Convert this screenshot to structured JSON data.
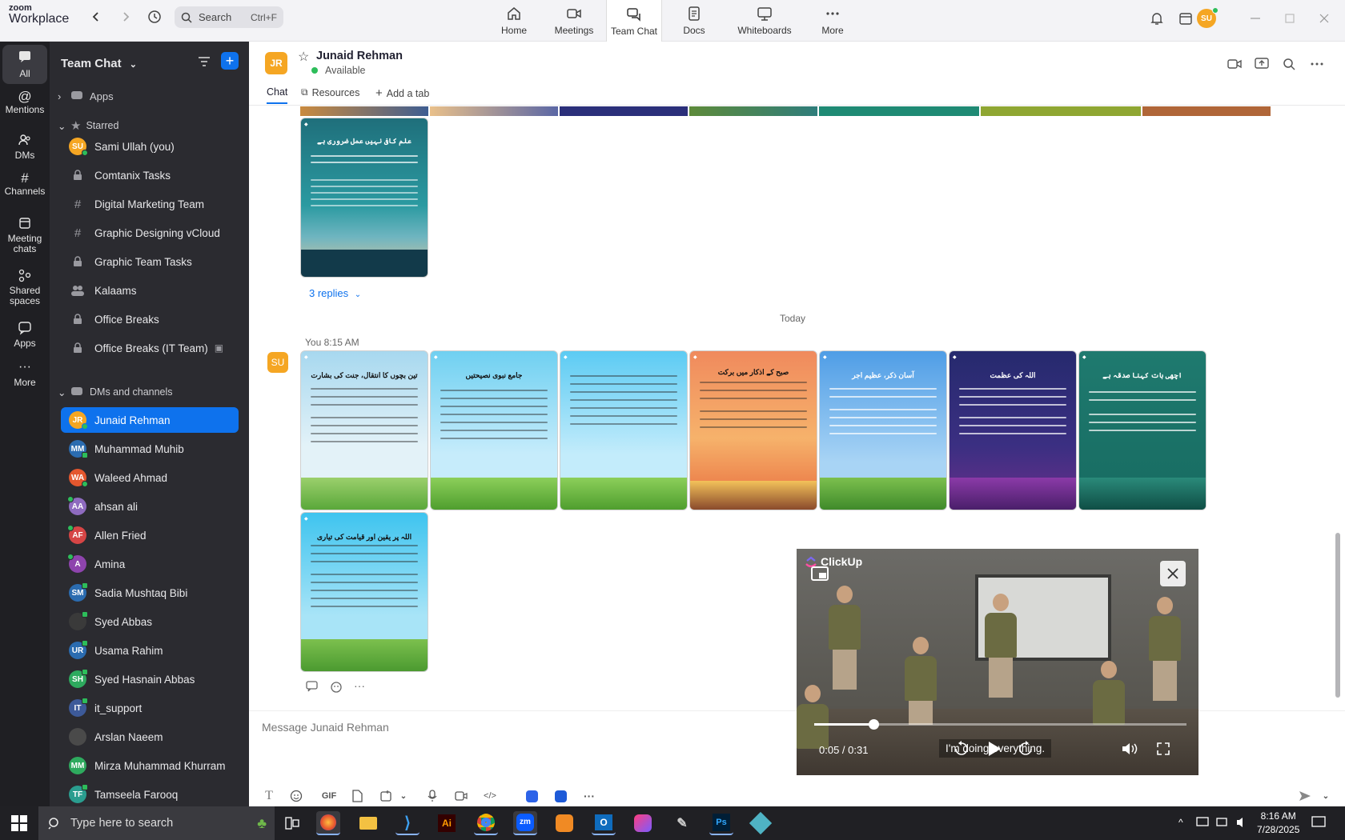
{
  "app": {
    "logo_line1": "zoom",
    "logo_line2": "Workplace"
  },
  "search": {
    "label": "Search",
    "shortcut": "Ctrl+F"
  },
  "nav_tabs": [
    {
      "label": "Home",
      "icon": "home-icon"
    },
    {
      "label": "Meetings",
      "icon": "video-camera-icon"
    },
    {
      "label": "Team Chat",
      "icon": "chat-icon",
      "active": true
    },
    {
      "label": "Docs",
      "icon": "document-icon"
    },
    {
      "label": "Whiteboards",
      "icon": "whiteboard-icon"
    },
    {
      "label": "More",
      "icon": "more-dots-icon"
    }
  ],
  "user": {
    "initials": "SU"
  },
  "rail": [
    {
      "label": "All",
      "active": true
    },
    {
      "label": "Mentions"
    },
    {
      "label": "DMs"
    },
    {
      "label": "Channels"
    },
    {
      "label": "Meeting chats"
    },
    {
      "label": "Shared spaces"
    },
    {
      "label": "Apps"
    },
    {
      "label": "More"
    }
  ],
  "sidebar": {
    "title": "Team Chat",
    "apps_label": "Apps",
    "starred_label": "Starred",
    "starred": [
      {
        "name": "Sami Ullah (you)",
        "initials": "SU",
        "color": "#f5a623",
        "kind": "user"
      },
      {
        "name": "Comtanix Tasks",
        "kind": "lock"
      },
      {
        "name": "Digital Marketing Team",
        "kind": "hash"
      },
      {
        "name": "Graphic Designing vCloud",
        "kind": "hash"
      },
      {
        "name": "Graphic Team Tasks",
        "kind": "lock"
      },
      {
        "name": "Kalaams",
        "kind": "group"
      },
      {
        "name": "Office Breaks",
        "kind": "lock"
      },
      {
        "name": "Office Breaks (IT Team)",
        "kind": "lock"
      }
    ],
    "dms_label": "DMs and channels",
    "dms": [
      {
        "name": "Junaid Rehman",
        "initials": "JR",
        "color": "#f5a623",
        "selected": true
      },
      {
        "name": "Muhammad Muhib",
        "initials": "MM",
        "color": "#2b6cb0"
      },
      {
        "name": "Waleed Ahmad",
        "initials": "WA",
        "color": "#e4572e"
      },
      {
        "name": "ahsan ali",
        "initials": "AA",
        "color": "#8e6bbf"
      },
      {
        "name": "Allen Fried",
        "initials": "AF",
        "color": "#d64545"
      },
      {
        "name": "Amina",
        "initials": "A",
        "color": "#8e44ad"
      },
      {
        "name": "Sadia Mushtaq Bibi",
        "initials": "SM",
        "color": "#2b6cb0"
      },
      {
        "name": "Syed Abbas",
        "initials": "",
        "color": "#3a3a3a"
      },
      {
        "name": "Usama Rahim",
        "initials": "UR",
        "color": "#2b6cb0"
      },
      {
        "name": "Syed Hasnain Abbas",
        "initials": "SH",
        "color": "#2eaa5e"
      },
      {
        "name": "it_support",
        "initials": "IT",
        "color": "#3d5a99"
      },
      {
        "name": "Arslan Naeem",
        "initials": "",
        "color": "#4a4a4a"
      },
      {
        "name": "Mirza Muhammad Khurram",
        "initials": "MM",
        "color": "#2eaa5e"
      },
      {
        "name": "Tamseela Farooq",
        "initials": "TF",
        "color": "#2a9d8f"
      }
    ]
  },
  "chat": {
    "contact_initials": "JR",
    "contact_name": "Junaid Rehman",
    "status": "Available",
    "tabs": {
      "chat": "Chat",
      "resources": "Resources",
      "add": "Add a tab"
    },
    "replies": "3 replies",
    "date_divider": "Today",
    "message_meta": "You 8:15 AM",
    "composer_placeholder": "Message Junaid Rehman",
    "gif_label": "GIF",
    "earlier_image": {
      "title": "علم کافی نہیں عمل ضروری ہے"
    },
    "images": [
      {
        "title": "تین بچوں کا انتقال، جنت کی بشارت"
      },
      {
        "title": "جامع نبوی نصیحتیں"
      },
      {
        "title": ""
      },
      {
        "title": "صبح کے اذکار میں برکت"
      },
      {
        "title": "آسان ذکر، عظیم اجر"
      },
      {
        "title": "اللہ کی عظمت"
      },
      {
        "title": "اچھی بات کہنا صدقہ ہے"
      },
      {
        "title": "اللہ پر یقین اور قیامت کی تیاری"
      }
    ]
  },
  "video": {
    "brand": "ClickUp",
    "time": "0:05 / 0:31",
    "caption": "I'm doing everything.",
    "progress_fraction": 0.16
  },
  "taskbar": {
    "search_placeholder": "Type here to search",
    "time": "8:16 AM",
    "date": "7/28/2025"
  }
}
